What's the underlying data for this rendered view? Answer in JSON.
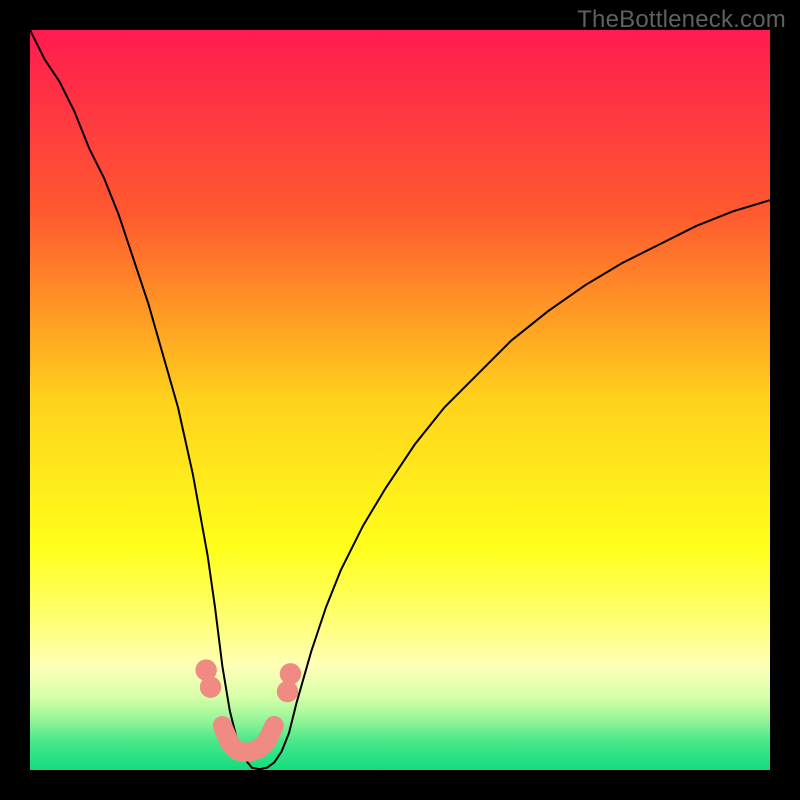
{
  "watermark": "TheBottleneck.com",
  "chart_data": {
    "type": "line",
    "title": "",
    "xlabel": "",
    "ylabel": "",
    "xlim": [
      0,
      100
    ],
    "ylim": [
      0,
      100
    ],
    "background_gradient": {
      "stops": [
        {
          "offset": 0.0,
          "color": "#ff1b50"
        },
        {
          "offset": 0.25,
          "color": "#ff5a2f"
        },
        {
          "offset": 0.5,
          "color": "#ffd21c"
        },
        {
          "offset": 0.7,
          "color": "#ffff1a"
        },
        {
          "offset": 0.8,
          "color": "#ffff77"
        },
        {
          "offset": 0.86,
          "color": "#ffffb8"
        },
        {
          "offset": 0.9,
          "color": "#d8ffa9"
        },
        {
          "offset": 0.93,
          "color": "#9bf69a"
        },
        {
          "offset": 0.96,
          "color": "#4be88a"
        },
        {
          "offset": 1.0,
          "color": "#11dd7e"
        }
      ]
    },
    "series": [
      {
        "name": "bottleneck-curve",
        "color": "#000000",
        "x": [
          0,
          2,
          4,
          6,
          8,
          10,
          12,
          14,
          16,
          18,
          20,
          22,
          24,
          25,
          26,
          27,
          28,
          29,
          30,
          31,
          32,
          33,
          34,
          35,
          36,
          38,
          40,
          42,
          45,
          48,
          52,
          56,
          60,
          65,
          70,
          75,
          80,
          85,
          90,
          95,
          100
        ],
        "y": [
          100,
          96,
          93,
          89,
          84,
          80,
          75,
          69,
          63,
          56,
          49,
          40,
          29,
          22,
          14,
          8,
          4,
          1.5,
          0.3,
          0.1,
          0.3,
          1.0,
          2.5,
          5,
          9,
          16,
          22,
          27,
          33,
          38,
          44,
          49,
          53,
          58,
          62,
          65.5,
          68.5,
          71,
          73.5,
          75.5,
          77
        ]
      }
    ],
    "markers": [
      {
        "name": "left-top-dot",
        "x": 23.8,
        "y": 13.5,
        "r": 1.45,
        "color": "#ef8b82"
      },
      {
        "name": "left-mid-dot",
        "x": 24.4,
        "y": 11.2,
        "r": 1.45,
        "color": "#ef8b82"
      },
      {
        "name": "right-top-dot",
        "x": 35.2,
        "y": 13.0,
        "r": 1.45,
        "color": "#ef8b82"
      },
      {
        "name": "right-mid-dot",
        "x": 34.8,
        "y": 10.6,
        "r": 1.45,
        "color": "#ef8b82"
      }
    ],
    "trough_band": {
      "color": "#ef8b82",
      "width": 2.6,
      "points_x": [
        26.0,
        27.0,
        28.0,
        29.0,
        30.0,
        31.0,
        32.0,
        33.0
      ],
      "points_y": [
        6.0,
        3.6,
        2.6,
        2.4,
        2.5,
        2.9,
        3.9,
        6.0
      ]
    }
  }
}
